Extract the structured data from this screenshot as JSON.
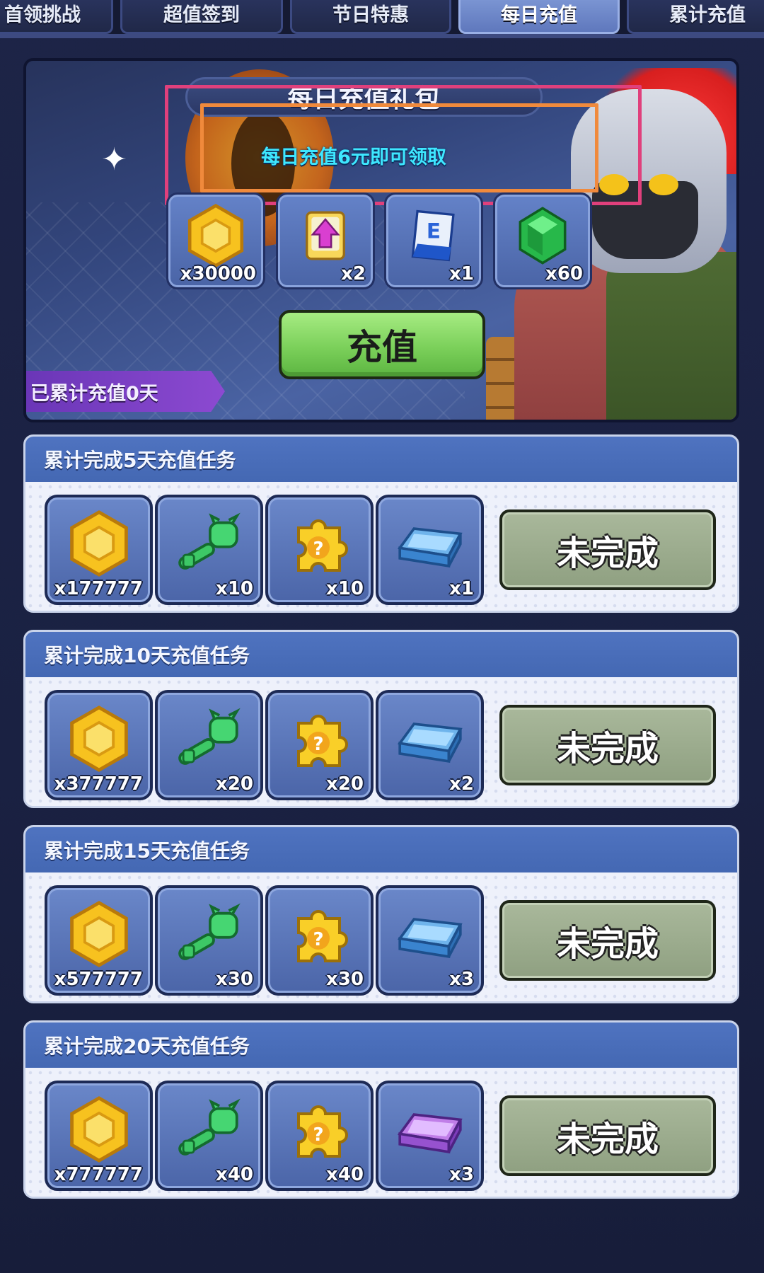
{
  "tabs": [
    {
      "label": "首领挑战",
      "active": false
    },
    {
      "label": "超值签到",
      "active": false
    },
    {
      "label": "节日特惠",
      "active": false
    },
    {
      "label": "每日充值",
      "active": true
    },
    {
      "label": "累计充值",
      "active": false
    }
  ],
  "banner": {
    "title": "每日充值礼包",
    "subtitle": "每日充值6元即可领取",
    "rewards": [
      {
        "icon": "gold-coin-icon",
        "qty": "x30000"
      },
      {
        "icon": "upgrade-card-icon",
        "qty": "x2"
      },
      {
        "icon": "blue-card-icon",
        "qty": "x1"
      },
      {
        "icon": "green-gem-icon",
        "qty": "x60"
      }
    ],
    "recharge_button": "充值",
    "days_label": "已累计充值0天"
  },
  "tasks": [
    {
      "title": "累计完成5天充值任务",
      "items": [
        {
          "icon": "gold-coin-icon",
          "qty": "x177777"
        },
        {
          "icon": "green-key-icon",
          "qty": "x10"
        },
        {
          "icon": "puzzle-piece-icon",
          "qty": "x10"
        },
        {
          "icon": "blue-ingot-icon",
          "qty": "x1"
        }
      ],
      "status": "未完成"
    },
    {
      "title": "累计完成10天充值任务",
      "items": [
        {
          "icon": "gold-coin-icon",
          "qty": "x377777"
        },
        {
          "icon": "green-key-icon",
          "qty": "x20"
        },
        {
          "icon": "puzzle-piece-icon",
          "qty": "x20"
        },
        {
          "icon": "blue-ingot-icon",
          "qty": "x2"
        }
      ],
      "status": "未完成"
    },
    {
      "title": "累计完成15天充值任务",
      "items": [
        {
          "icon": "gold-coin-icon",
          "qty": "x577777"
        },
        {
          "icon": "green-key-icon",
          "qty": "x30"
        },
        {
          "icon": "puzzle-piece-icon",
          "qty": "x30"
        },
        {
          "icon": "blue-ingot-icon",
          "qty": "x3"
        }
      ],
      "status": "未完成"
    },
    {
      "title": "累计完成20天充值任务",
      "items": [
        {
          "icon": "gold-coin-icon",
          "qty": "x777777"
        },
        {
          "icon": "green-key-icon",
          "qty": "x40"
        },
        {
          "icon": "puzzle-piece-icon",
          "qty": "x40"
        },
        {
          "icon": "purple-ingot-icon",
          "qty": "x3"
        }
      ],
      "status": "未完成"
    }
  ],
  "colors": {
    "highlight_outer": "#e0407c",
    "highlight_inner": "#f08a3c",
    "subtitle": "#3ee7ff",
    "recharge_green": "#7bd05a",
    "status_gray_green": "#9aab8c"
  }
}
